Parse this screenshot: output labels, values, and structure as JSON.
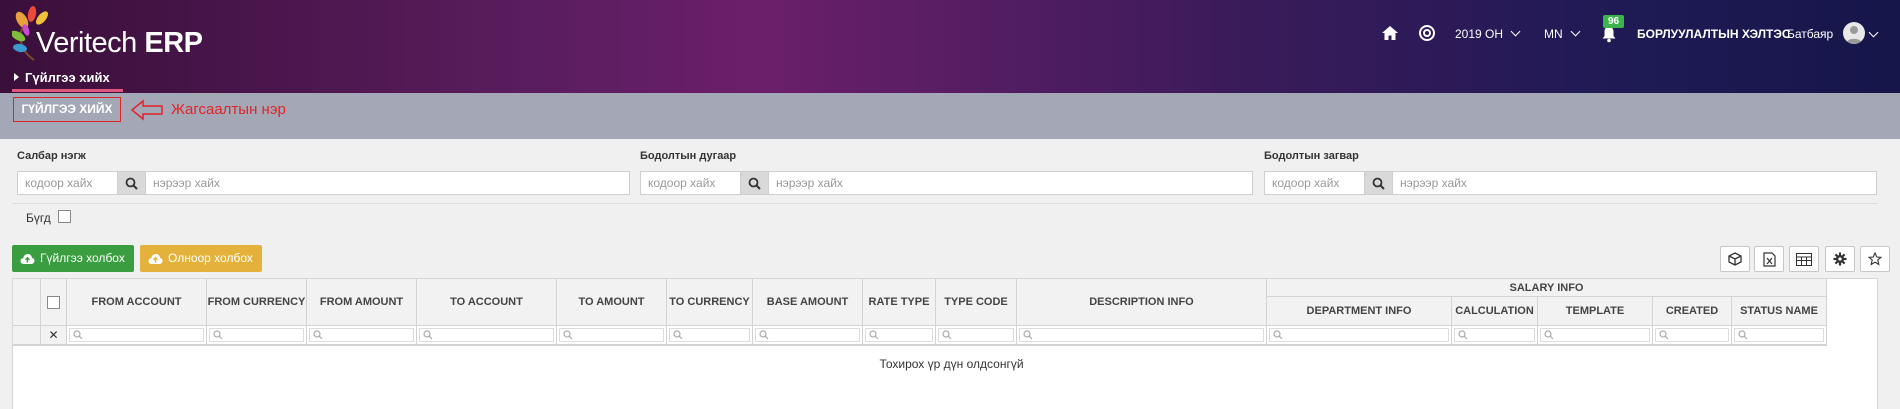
{
  "app": {
    "brand_light": "Veritech",
    "brand_bold": "ERP"
  },
  "breadcrumb": {
    "label": "Гүйлгээ хийх"
  },
  "header_right": {
    "year": "2019 ОН",
    "language": "MN",
    "notification_count": "96",
    "department": "БОРЛУУЛАЛТЫН ХЭЛТЭС",
    "user_name": "Батбаяр"
  },
  "page_title": "ГҮЙЛГЭЭ ХИЙХ",
  "annotation": "Жагсаалтын нэр",
  "filters": [
    {
      "label": "Салбар нэгж",
      "code_placeholder": "кодоор хайх",
      "name_placeholder": "нэрээр хайх"
    },
    {
      "label": "Бодолтын дугаар",
      "code_placeholder": "кодоор хайх",
      "name_placeholder": "нэрээр хайх"
    },
    {
      "label": "Бодолтын загвар",
      "code_placeholder": "кодоор хайх",
      "name_placeholder": "нэрээр хайх"
    }
  ],
  "all_checkbox_label": "Бүгд",
  "buttons": {
    "connect_transaction": "Гүйлгээ холбох",
    "bulk_connect": "Олноор холбох"
  },
  "colors": {
    "green": "#3a9d3f",
    "yellow": "#e4b23b",
    "annotation_red": "#e0242a"
  },
  "toolbar_icons": [
    "cube-icon",
    "excel-export-icon",
    "table-layout-icon",
    "gear-icon",
    "star-icon"
  ],
  "grid": {
    "group_header": "SALARY INFO",
    "columns": [
      "FROM ACCOUNT",
      "FROM CURRENCY",
      "FROM AMOUNT",
      "TO ACCOUNT",
      "TO AMOUNT",
      "TO CURRENCY",
      "BASE AMOUNT",
      "RATE TYPE",
      "TYPE CODE",
      "DESCRIPTION INFO"
    ],
    "group_columns": [
      "DEPARTMENT INFO",
      "CALCULATION",
      "TEMPLATE",
      "CREATED",
      "STATUS NAME"
    ],
    "clear_filter_symbol": "✕",
    "empty_message": "Тохирох үр дүн олдсонгүй"
  }
}
